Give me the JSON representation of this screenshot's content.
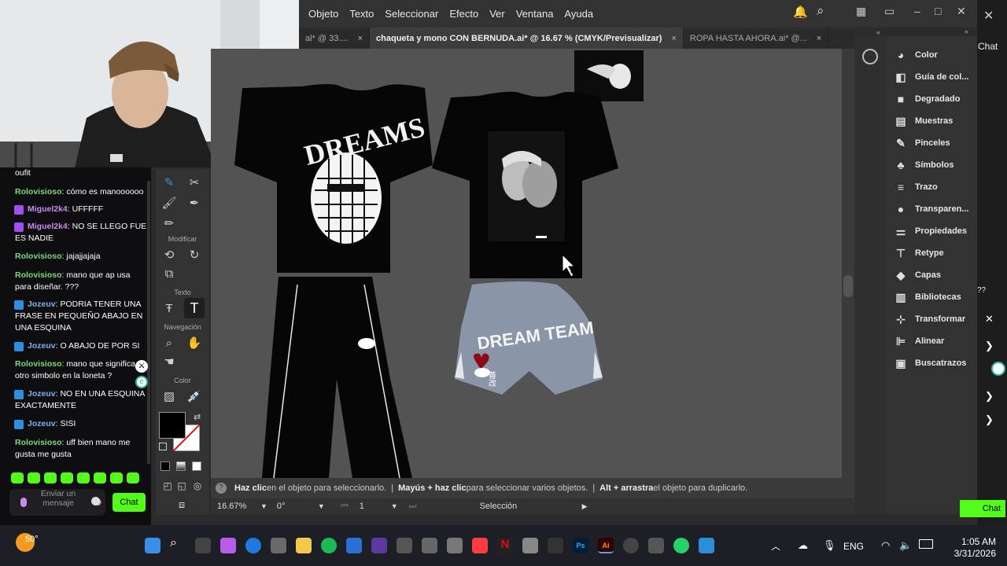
{
  "illustrator": {
    "menu": [
      "Objeto",
      "Texto",
      "Seleccionar",
      "Efecto",
      "Ver",
      "Ventana",
      "Ayuda"
    ],
    "tabs": [
      {
        "label": "al* @ 33....",
        "active": false
      },
      {
        "label": "chaqueta y mono CON BERNUDA.ai* @ 16.67 % (CMYK/Previsualizar)",
        "active": true
      },
      {
        "label": "ROPA HASTA AHORA.ai* @...",
        "active": false
      }
    ],
    "close_glyph": "×",
    "status": {
      "part1_bold": "Haz clic",
      "part1": " en el objeto para seleccionarlo.",
      "sep": "|",
      "part2_bold": "Mayús + haz clic",
      "part2": " para seleccionar varios objetos.",
      "part3_bold": "Alt + arrastra",
      "part3": " el objeto para duplicarlo."
    },
    "bottom": {
      "zoom": "16.67%",
      "rotation": "0°",
      "artboard": "1",
      "mode": "Selección"
    },
    "toolbar_sections": {
      "modify": "Modificar",
      "text": "Texto",
      "nav": "Navegación",
      "color": "Color"
    },
    "panels": [
      "Color",
      "Guía de col...",
      "Degradado",
      "Muestras",
      "Pinceles",
      "Símbolos",
      "Trazo",
      "Transparen...",
      "Propiedades",
      "Retype",
      "Capas",
      "Bibliotecas",
      "Transformar",
      "Alinear",
      "Buscatrazos"
    ],
    "artwork": {
      "shirt1_text": "DREAMS",
      "shorts_text": "DREAM TEAM",
      "shorts_kanji": "善改"
    }
  },
  "chat": {
    "top_fragment": "oufit",
    "messages": [
      {
        "user": "Rolovisioso",
        "text": "cómo es manoooooo",
        "style": "u1",
        "badge": false
      },
      {
        "user": "Miguel2k4",
        "text": "UFFFFF",
        "style": "u2",
        "badge": true
      },
      {
        "user": "Miguel2k4",
        "text": "NO SE LLEGO FUE ES NADIE",
        "style": "u2",
        "badge": true
      },
      {
        "user": "Rolovisioso",
        "text": "jajajjajaja",
        "style": "u1",
        "badge": false
      },
      {
        "user": "Rolovisioso",
        "text": "mano que ap usa para diseñar. ???",
        "style": "u1",
        "badge": false
      },
      {
        "user": "Jozeuv",
        "text": "PODRIA TENER UNA FRASE EN PEQUEÑO ABAJO EN UNA ESQUINA",
        "style": "u3",
        "badge": true
      },
      {
        "user": "Jozeuv",
        "text": "O ABAJO DE POR SI",
        "style": "u3",
        "badge": true
      },
      {
        "user": "Rolovisioso",
        "text": "mano que significa el otro simbolo en la loneta ?",
        "style": "u1",
        "badge": false
      },
      {
        "user": "Jozeuv",
        "text": "NO EN UNA ESQUINA EXACTAMENTE",
        "style": "u3",
        "badge": true
      },
      {
        "user": "Jozeuv",
        "text": "SISI",
        "style": "u3",
        "badge": true
      },
      {
        "user": "Rolovisioso",
        "text": "uff bien mano me gusta me gusta",
        "style": "u1",
        "badge": false
      }
    ],
    "input_placeholder": "Enviar un mensaje",
    "send_label": "Chat",
    "side_label": "Chat",
    "side_fragment": "??"
  },
  "taskbar": {
    "temp": "50°",
    "lang": "ENG",
    "time": "1:05 AM",
    "date": "3/31/2026",
    "chat_btn": "Chat"
  }
}
